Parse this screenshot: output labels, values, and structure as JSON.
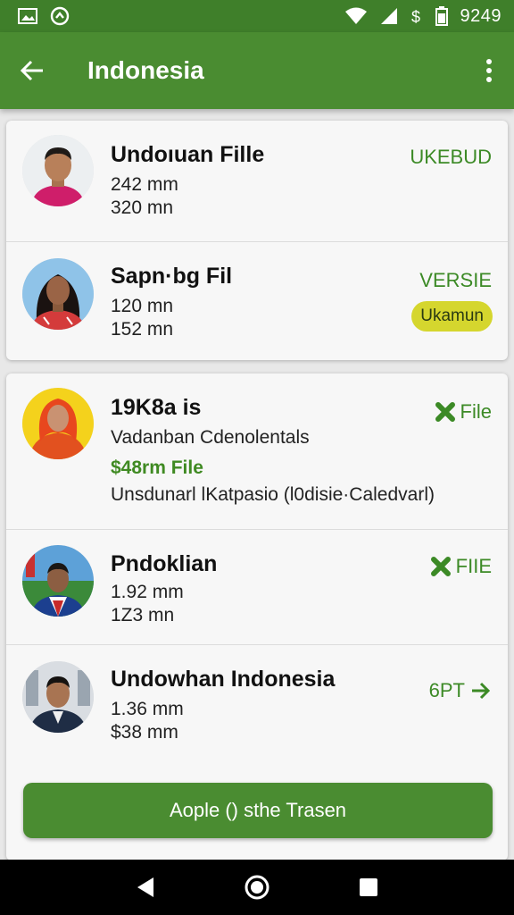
{
  "status_bar": {
    "time": "9249",
    "left_icons": [
      "image-icon",
      "sync-icon"
    ],
    "right_icons": [
      "wifi-icon",
      "signal-icon",
      "dollar-icon",
      "battery-icon"
    ]
  },
  "app_bar": {
    "title": "Indonesia",
    "back_icon": "arrow-left-icon",
    "menu_icon": "more-vert-icon"
  },
  "card_1": {
    "rows": [
      {
        "title": "Undoıuan Fille",
        "line1": "242  mm",
        "line2": "320 mn",
        "action": "UKEBUD",
        "avatar": "person-avatar-pink-shirt"
      },
      {
        "title": "Sapn·bg Fil",
        "line1": "120  mn",
        "line2": "152 mn",
        "action": "VERSIE",
        "badge": "Ukamun",
        "avatar": "person-avatar-woman"
      }
    ]
  },
  "card_2": {
    "rows": [
      {
        "title": "19K8a is",
        "line1": "Vadanban Cdenolentals",
        "line2": "$48rm File",
        "line3": "Unsdunarl lKatpasio (l0disie·Caledvarl)",
        "action": "File",
        "action_icon": "cross-icon",
        "avatar": "person-avatar-headscarf"
      },
      {
        "title": "Pndoklian",
        "line1": "1.92  mm",
        "line2": "1Z3 mn",
        "action": "FIIE",
        "action_icon": "cross-icon",
        "avatar": "person-avatar-flag"
      },
      {
        "title": "Undowhan Indonesia",
        "line1": "1.36  mm",
        "line2": "$38 mm",
        "action": "6PT",
        "action_icon": "arrow-right-icon",
        "avatar": "person-avatar-suit"
      }
    ],
    "primary_button": "Aople () sthe Trasen"
  },
  "nav_bar": {
    "icons": [
      "back-triangle-icon",
      "home-circle-icon",
      "recents-square-icon"
    ]
  },
  "colors": {
    "primary": "#4a8c31",
    "status_bar": "#3f7f2a",
    "accent_text": "#3c8a26",
    "badge": "#d5d62e"
  }
}
